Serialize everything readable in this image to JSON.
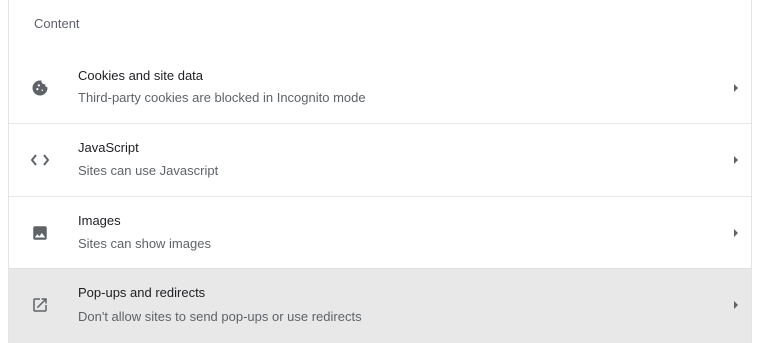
{
  "section": {
    "title": "Content"
  },
  "rows": [
    {
      "icon": "cookie-icon",
      "title": "Cookies and site data",
      "subtitle": "Third-party cookies are blocked in Incognito mode"
    },
    {
      "icon": "code-brackets-icon",
      "title": "JavaScript",
      "subtitle": "Sites can use Javascript"
    },
    {
      "icon": "image-icon",
      "title": "Images",
      "subtitle": "Sites can show images"
    },
    {
      "icon": "open-in-new-icon",
      "title": "Pop-ups and redirects",
      "subtitle": "Don't allow sites to send pop-ups or use redirects"
    }
  ],
  "colors": {
    "title_text": "#202124",
    "secondary_text": "#5f6368",
    "icon": "#5f6368",
    "hover_row_bg": "#e8e8e8",
    "divider": "#e8e8e8"
  }
}
